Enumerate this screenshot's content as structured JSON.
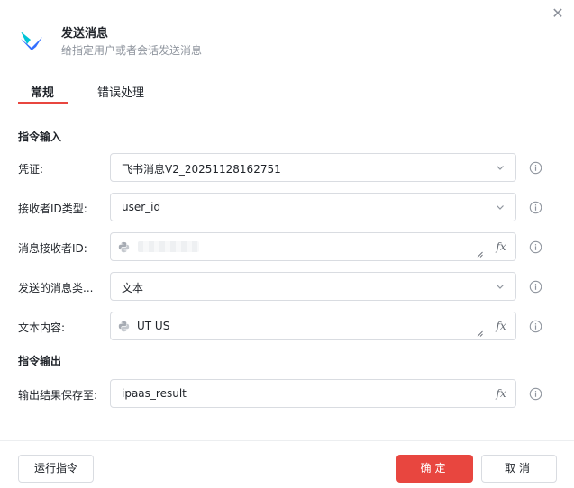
{
  "dialog": {
    "title": "发送消息",
    "subtitle": "给指定用户或者会话发送消息",
    "close_glyph": "✕"
  },
  "tabs": [
    {
      "label": "常规",
      "active": true
    },
    {
      "label": "错误处理",
      "active": false
    }
  ],
  "sections": {
    "input_title": "指令输入",
    "output_title": "指令输出"
  },
  "fields": {
    "credential": {
      "label": "凭证:",
      "value": "飞书消息V2_20251128162751",
      "type": "select"
    },
    "receiver_id_type": {
      "label": "接收者ID类型:",
      "value": "user_id",
      "type": "select"
    },
    "receiver_id": {
      "label": "消息接收者ID:",
      "value": "",
      "type": "expression",
      "masked": true
    },
    "message_type": {
      "label": "发送的消息类...",
      "value": "文本",
      "type": "select"
    },
    "text_content": {
      "label": "文本内容:",
      "value": "UT US",
      "type": "expression"
    },
    "save_result": {
      "label": "输出结果保存至:",
      "value": "ipaas_result",
      "type": "variable"
    }
  },
  "fx_label": "fx",
  "icons": {
    "logo": "app-logo-icon",
    "python": "python-icon",
    "info": "info-icon",
    "chevron": "chevron-down-icon",
    "close": "close-icon"
  },
  "colors": {
    "accent": "#e8463f",
    "border": "#d9dce1",
    "muted_text": "#8f959e",
    "logo_blue": "#3370ff",
    "logo_cyan": "#00c4d6"
  },
  "footer": {
    "run_label": "运行指令",
    "confirm_label": "确定",
    "cancel_label": "取消"
  }
}
